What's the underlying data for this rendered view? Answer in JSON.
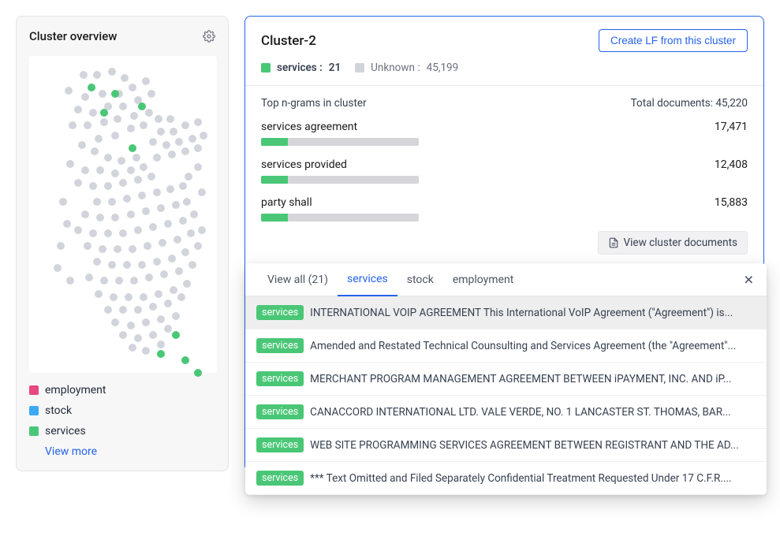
{
  "sidebar": {
    "title": "Cluster overview",
    "legend": [
      {
        "label": "employment",
        "color": "#e8467e"
      },
      {
        "label": "stock",
        "color": "#3da9f5"
      },
      {
        "label": "services",
        "color": "#4ac776"
      }
    ],
    "view_more": "View more"
  },
  "cluster": {
    "title": "Cluster-2",
    "create_lf_label": "Create LF from this cluster",
    "services_label": "services :",
    "services_count": "21",
    "unknown_label": "Unknown :",
    "unknown_count": "45,199",
    "ngram_header": "Top n-grams in cluster",
    "total_docs_label": "Total documents: 45,220",
    "ngrams": [
      {
        "term": "services agreement",
        "count": "17,471",
        "pct": 17
      },
      {
        "term": "services provided",
        "count": "12,408",
        "pct": 17
      },
      {
        "term": "party shall",
        "count": "15,883",
        "pct": 17
      }
    ],
    "view_docs_label": "View cluster documents"
  },
  "docs_panel": {
    "tabs": [
      {
        "label": "View all (21)",
        "active": false
      },
      {
        "label": "services",
        "active": true
      },
      {
        "label": "stock",
        "active": false
      },
      {
        "label": "employment",
        "active": false
      }
    ],
    "items": [
      {
        "badge": "services",
        "text": "INTERNATIONAL VOIP AGREEMENT This International VoIP Agreement (\"Agreement\") is...",
        "highlighted": true
      },
      {
        "badge": "services",
        "text": "Amended and Restated Technical Counsulting and Services Agreement (the \"Agreement\"...",
        "highlighted": false
      },
      {
        "badge": "services",
        "text": "MERCHANT PROGRAM MANAGEMENT AGREEMENT BETWEEN iPAYMENT, INC. AND iP...",
        "highlighted": false
      },
      {
        "badge": "services",
        "text": "CANACCORD INTERNATIONAL LTD. VALE VERDE, NO. 1 LANCASTER ST. THOMAS, BAR...",
        "highlighted": false
      },
      {
        "badge": "services",
        "text": "WEB SITE PROGRAMMING SERVICES AGREEMENT BETWEEN REGISTRANT AND THE AD...",
        "highlighted": false
      },
      {
        "badge": "services",
        "text": "*** Text Omitted and Filed Separately Confidential Treatment Requested Under 17 C.F.R....",
        "highlighted": false
      }
    ]
  },
  "scatter": {
    "gray": [
      [
        29,
        6
      ],
      [
        36,
        6
      ],
      [
        44,
        5
      ],
      [
        51,
        7
      ],
      [
        21,
        11
      ],
      [
        30,
        13
      ],
      [
        39,
        12
      ],
      [
        48,
        12
      ],
      [
        55,
        10
      ],
      [
        62,
        8
      ],
      [
        26,
        17
      ],
      [
        34,
        18
      ],
      [
        42,
        16
      ],
      [
        50,
        16
      ],
      [
        58,
        14
      ],
      [
        65,
        12
      ],
      [
        23,
        22
      ],
      [
        31,
        22
      ],
      [
        40,
        21
      ],
      [
        47,
        20
      ],
      [
        56,
        19
      ],
      [
        64,
        18
      ],
      [
        37,
        26
      ],
      [
        46,
        25
      ],
      [
        54,
        23
      ],
      [
        61,
        22
      ],
      [
        69,
        20
      ],
      [
        75,
        20
      ],
      [
        70,
        24
      ],
      [
        77,
        24
      ],
      [
        83,
        22
      ],
      [
        90,
        21
      ],
      [
        66,
        27
      ],
      [
        73,
        28
      ],
      [
        80,
        27
      ],
      [
        87,
        26
      ],
      [
        93,
        25
      ],
      [
        68,
        32
      ],
      [
        76,
        31
      ],
      [
        83,
        30
      ],
      [
        90,
        29
      ],
      [
        28,
        28
      ],
      [
        35,
        30
      ],
      [
        42,
        32
      ],
      [
        49,
        33
      ],
      [
        57,
        32
      ],
      [
        22,
        34
      ],
      [
        30,
        36
      ],
      [
        38,
        36
      ],
      [
        46,
        37
      ],
      [
        54,
        36
      ],
      [
        61,
        35
      ],
      [
        26,
        40
      ],
      [
        34,
        41
      ],
      [
        42,
        41
      ],
      [
        50,
        40
      ],
      [
        58,
        39
      ],
      [
        65,
        38
      ],
      [
        36,
        46
      ],
      [
        44,
        46
      ],
      [
        52,
        45
      ],
      [
        60,
        44
      ],
      [
        68,
        43
      ],
      [
        75,
        42
      ],
      [
        82,
        41
      ],
      [
        30,
        50
      ],
      [
        38,
        51
      ],
      [
        46,
        51
      ],
      [
        54,
        50
      ],
      [
        62,
        49
      ],
      [
        70,
        48
      ],
      [
        78,
        47
      ],
      [
        84,
        46
      ],
      [
        26,
        55
      ],
      [
        34,
        56
      ],
      [
        42,
        56
      ],
      [
        50,
        56
      ],
      [
        58,
        55
      ],
      [
        66,
        54
      ],
      [
        74,
        53
      ],
      [
        82,
        52
      ],
      [
        88,
        50
      ],
      [
        31,
        60
      ],
      [
        39,
        61
      ],
      [
        47,
        61
      ],
      [
        55,
        61
      ],
      [
        63,
        60
      ],
      [
        71,
        59
      ],
      [
        79,
        58
      ],
      [
        86,
        56
      ],
      [
        92,
        55
      ],
      [
        36,
        65
      ],
      [
        44,
        66
      ],
      [
        52,
        66
      ],
      [
        60,
        66
      ],
      [
        68,
        65
      ],
      [
        76,
        64
      ],
      [
        83,
        62
      ],
      [
        90,
        60
      ],
      [
        32,
        70
      ],
      [
        40,
        71
      ],
      [
        48,
        71
      ],
      [
        56,
        71
      ],
      [
        64,
        70
      ],
      [
        72,
        69
      ],
      [
        80,
        68
      ],
      [
        87,
        66
      ],
      [
        37,
        75
      ],
      [
        45,
        76
      ],
      [
        53,
        76
      ],
      [
        61,
        76
      ],
      [
        69,
        75
      ],
      [
        77,
        74
      ],
      [
        84,
        72
      ],
      [
        42,
        80
      ],
      [
        50,
        80
      ],
      [
        58,
        80
      ],
      [
        66,
        79
      ],
      [
        74,
        78
      ],
      [
        81,
        76
      ],
      [
        46,
        84
      ],
      [
        54,
        85
      ],
      [
        62,
        84
      ],
      [
        70,
        83
      ],
      [
        78,
        82
      ],
      [
        50,
        88
      ],
      [
        58,
        89
      ],
      [
        66,
        88
      ],
      [
        74,
        86
      ],
      [
        55,
        92
      ],
      [
        62,
        93
      ],
      [
        70,
        91
      ],
      [
        18,
        46
      ],
      [
        20,
        53
      ],
      [
        17,
        60
      ],
      [
        15,
        67
      ],
      [
        22,
        71
      ],
      [
        90,
        35
      ],
      [
        85,
        38
      ],
      [
        92,
        43
      ]
    ],
    "green": [
      [
        33,
        10
      ],
      [
        46,
        12
      ],
      [
        60,
        16
      ],
      [
        40,
        18
      ],
      [
        55,
        29
      ],
      [
        70,
        94
      ],
      [
        83,
        96
      ],
      [
        90,
        100
      ],
      [
        78,
        88
      ]
    ]
  }
}
